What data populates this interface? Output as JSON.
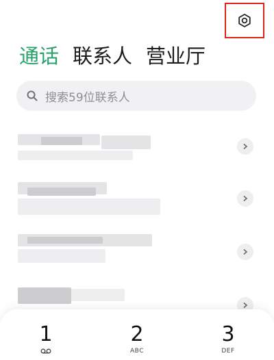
{
  "header": {
    "tabs": [
      {
        "label": "通话",
        "active": true
      },
      {
        "label": "联系人",
        "active": false
      },
      {
        "label": "营业厅",
        "active": false
      }
    ],
    "settings_icon": "gear-icon"
  },
  "search": {
    "placeholder": "搜索59位联系人",
    "icon": "search-icon"
  },
  "contacts": [
    {
      "blurred": true
    },
    {
      "blurred": true
    },
    {
      "blurred": true
    },
    {
      "blurred": true
    }
  ],
  "dialpad": {
    "keys": [
      {
        "digit": "1",
        "sub": "voicemail-icon"
      },
      {
        "digit": "2",
        "sub": "ABC"
      },
      {
        "digit": "3",
        "sub": "DEF"
      }
    ]
  },
  "colors": {
    "accent": "#27a26a",
    "highlight_border": "#e0221d",
    "search_bg": "#f1f1f3"
  }
}
